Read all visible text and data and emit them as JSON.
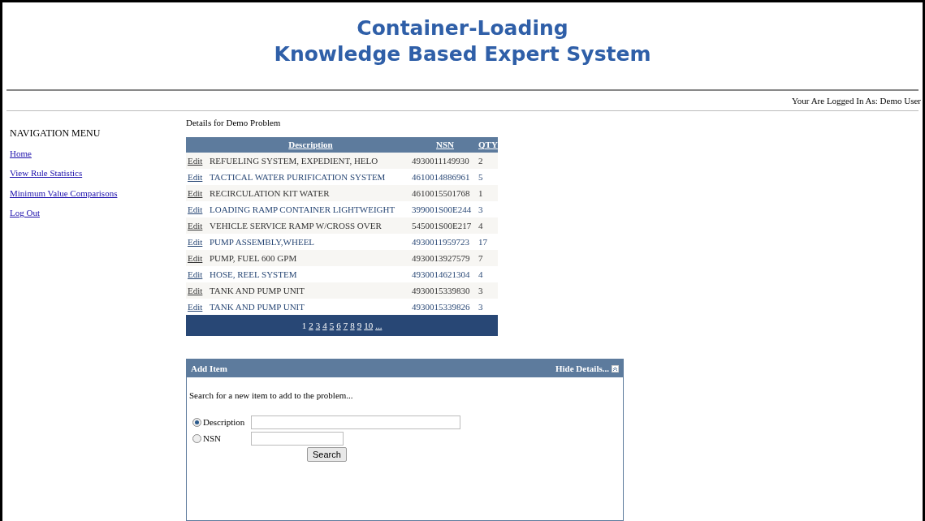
{
  "header": {
    "title_lines": [
      "Container-Loading",
      "Knowledge Based Expert System"
    ],
    "login_status": "Your Are Logged In As: Demo User"
  },
  "navigation": {
    "heading": "NAVIGATION MENU",
    "items": [
      {
        "label": "Home"
      },
      {
        "label": "View Rule Statistics"
      },
      {
        "label": "Minimum Value Comparisons"
      },
      {
        "label": "Log Out"
      }
    ]
  },
  "details": {
    "title": "Details for Demo Problem",
    "table": {
      "columns": [
        "Description",
        "NSN",
        "QTY"
      ],
      "rows": [
        {
          "action": "Edit",
          "description": "REFUELING SYSTEM, EXPEDIENT, HELO",
          "nsn": "4930011149930",
          "qty": "2"
        },
        {
          "action": "Edit",
          "description": "TACTICAL WATER PURIFICATION SYSTEM",
          "nsn": "4610014886961",
          "qty": "5"
        },
        {
          "action": "Edit",
          "description": "RECIRCULATION KIT WATER",
          "nsn": "4610015501768",
          "qty": "1"
        },
        {
          "action": "Edit",
          "description": "LOADING RAMP CONTAINER LIGHTWEIGHT",
          "nsn": "399001S00E244",
          "qty": "3"
        },
        {
          "action": "Edit",
          "description": "VEHICLE SERVICE RAMP W/CROSS OVER",
          "nsn": "545001S00E217",
          "qty": "4"
        },
        {
          "action": "Edit",
          "description": "PUMP ASSEMBLY,WHEEL",
          "nsn": "4930011959723",
          "qty": "17"
        },
        {
          "action": "Edit",
          "description": "PUMP, FUEL 600 GPM",
          "nsn": "4930013927579",
          "qty": "7"
        },
        {
          "action": "Edit",
          "description": "HOSE, REEL SYSTEM",
          "nsn": "4930014621304",
          "qty": "4"
        },
        {
          "action": "Edit",
          "description": "TANK AND PUMP UNIT",
          "nsn": "4930015339830",
          "qty": "3"
        },
        {
          "action": "Edit",
          "description": "TANK AND PUMP UNIT",
          "nsn": "4930015339826",
          "qty": "3"
        }
      ],
      "pages": [
        {
          "label": "1",
          "selected": true
        },
        {
          "label": "2",
          "selected": false
        },
        {
          "label": "3",
          "selected": false
        },
        {
          "label": "4",
          "selected": false
        },
        {
          "label": "5",
          "selected": false
        },
        {
          "label": "6",
          "selected": false
        },
        {
          "label": "7",
          "selected": false
        },
        {
          "label": "8",
          "selected": false
        },
        {
          "label": "9",
          "selected": false
        },
        {
          "label": "10",
          "selected": false
        },
        {
          "label": "...",
          "selected": false
        }
      ]
    }
  },
  "add_item": {
    "title": "Add Item",
    "toggle": "Hide Details...",
    "prompt": "Search for a new item to add to the problem...",
    "options": [
      {
        "label": "Description",
        "selected": true,
        "kind": "wide"
      },
      {
        "label": "NSN",
        "selected": false,
        "kind": "narrow"
      }
    ],
    "button": "Search"
  }
}
